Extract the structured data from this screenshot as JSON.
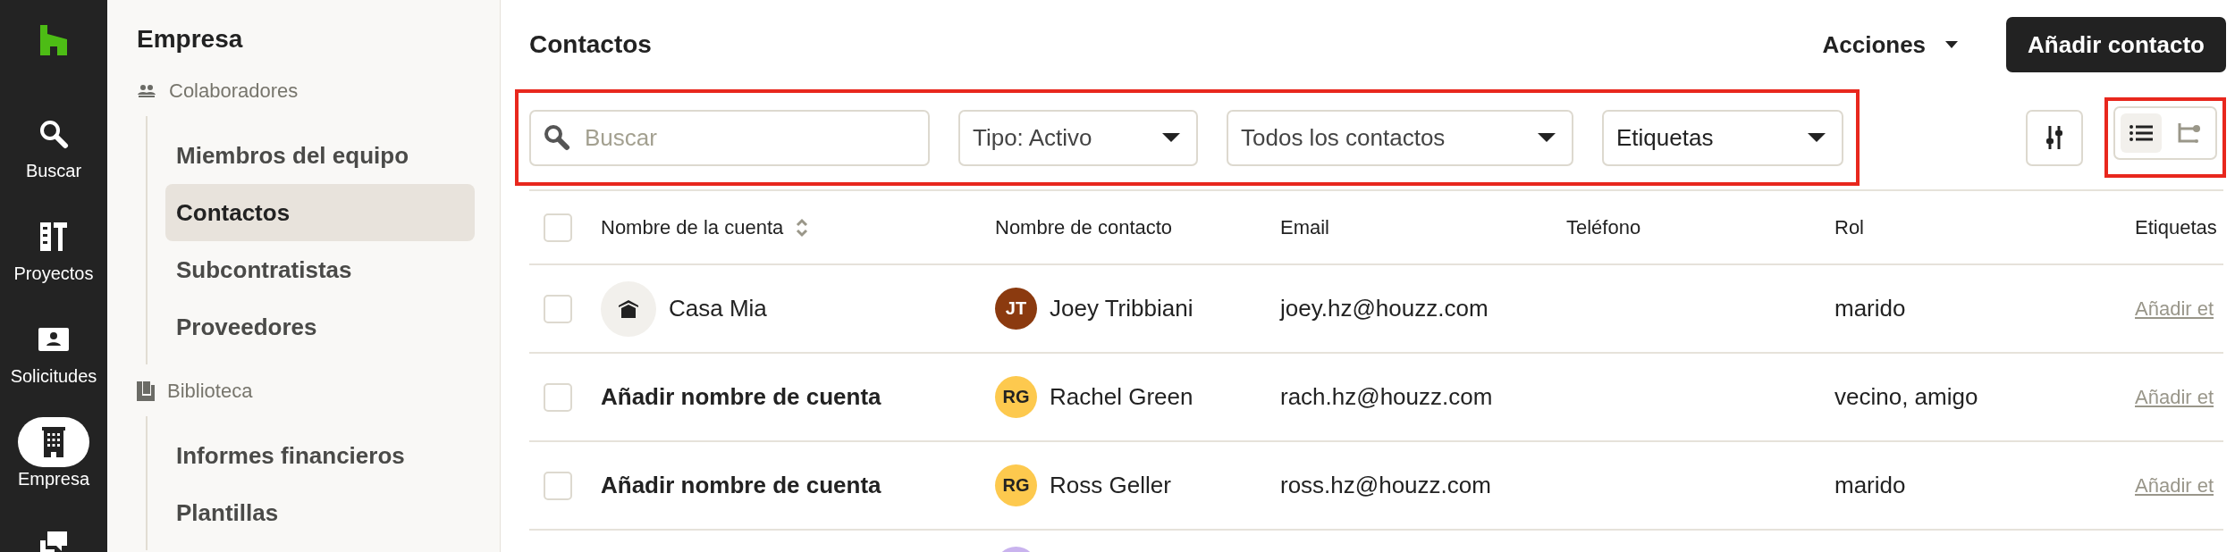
{
  "rail": [
    {
      "kind": "search",
      "label": "Buscar",
      "selected": false
    },
    {
      "kind": "projects",
      "label": "Proyectos",
      "selected": false
    },
    {
      "kind": "requests",
      "label": "Solicitudes",
      "selected": false
    },
    {
      "kind": "company",
      "label": "Empresa",
      "selected": true
    },
    {
      "kind": "chat",
      "selected": false
    }
  ],
  "sidebar": {
    "title": "Empresa",
    "sections": [
      {
        "kind": "people",
        "label": "Colaboradores",
        "items": [
          {
            "label": "Miembros del equipo",
            "selected": false
          },
          {
            "label": "Contactos",
            "selected": true
          },
          {
            "label": "Subcontratistas",
            "selected": false
          },
          {
            "label": "Proveedores",
            "selected": false
          }
        ]
      },
      {
        "kind": "library",
        "label": "Biblioteca",
        "items": [
          {
            "label": "Informes financieros",
            "selected": false
          },
          {
            "label": "Plantillas",
            "selected": false
          }
        ]
      }
    ]
  },
  "header": {
    "title": "Contactos",
    "actions": "Acciones",
    "primary_button": "Añadir contacto"
  },
  "filters": {
    "search": {
      "placeholder": "Buscar"
    },
    "dropdowns": [
      "Tipo: Activo",
      "Todos los contactos",
      "Etiquetas"
    ]
  },
  "views": [
    {
      "kind": "list",
      "selected": true
    },
    {
      "kind": "tree",
      "selected": false
    }
  ],
  "table": {
    "select_all": {
      "checked": false
    },
    "columns": [
      {
        "label": "Nombre de la cuenta",
        "sortable": true
      },
      {
        "label": "Nombre de contacto"
      },
      {
        "label": "Email"
      },
      {
        "label": "Teléfono"
      },
      {
        "label": "Rol"
      },
      {
        "label": "Etiquetas"
      }
    ],
    "rows": [
      {
        "checked": false,
        "kind": "named",
        "account": "Casa Mia",
        "initials": "JT",
        "color": "#8b3a0f",
        "contact": "Joey Tribbiani",
        "email": "joey.hz@houzz.com",
        "role": "marido",
        "tags": "Añadir et"
      },
      {
        "checked": false,
        "kind": "placeholder",
        "account": "Añadir nombre de cuenta",
        "initials": "RG",
        "color": "#fdc94e",
        "contact": "Rachel Green",
        "email": "rach.hz@houzz.com",
        "role": "vecino, amigo",
        "tags": "Añadir et"
      },
      {
        "checked": false,
        "kind": "placeholder",
        "account": "Añadir nombre de cuenta",
        "initials": "RG",
        "color": "#fdc94e",
        "contact": "Ross Geller",
        "email": "ross.hz@houzz.com",
        "role": "marido",
        "tags": "Añadir et"
      },
      {
        "kind": "partial",
        "color": "#c9b3ee"
      }
    ]
  }
}
